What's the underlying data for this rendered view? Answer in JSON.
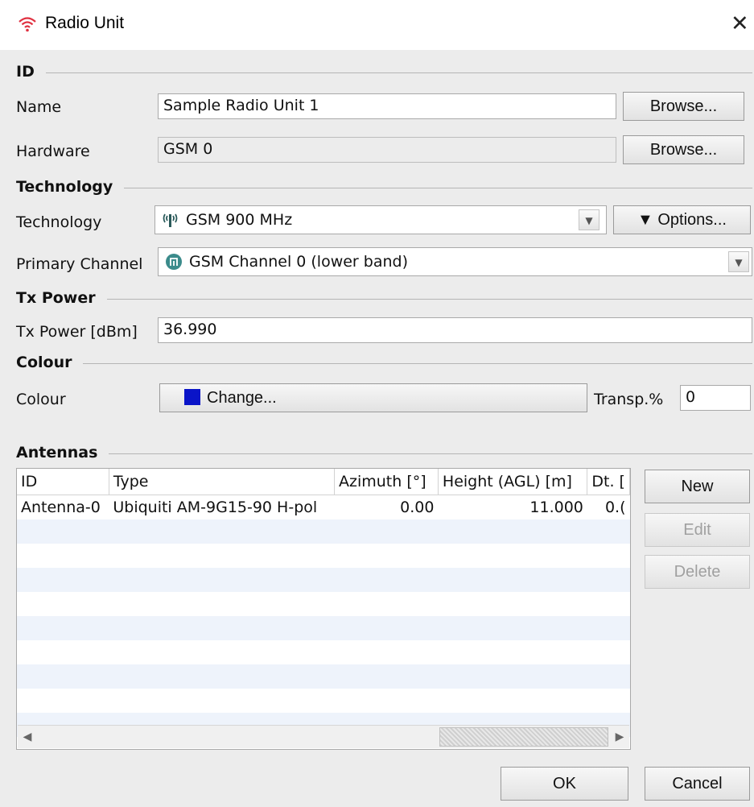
{
  "window": {
    "title": "Radio Unit",
    "close_glyph": "✕"
  },
  "id_section": {
    "title": "ID",
    "name_label": "Name",
    "name_value": "Sample Radio Unit 1",
    "name_browse": "Browse...",
    "hardware_label": "Hardware",
    "hardware_value": "GSM 0",
    "hardware_browse": "Browse..."
  },
  "technology_section": {
    "title": "Technology",
    "technology_label": "Technology",
    "technology_value": "GSM 900 MHz",
    "options_label": "▼ Options...",
    "primary_channel_label": "Primary Channel",
    "primary_channel_value": "GSM Channel 0 (lower band)"
  },
  "tx_power_section": {
    "title": "Tx Power",
    "label": "Tx Power [dBm]",
    "value": "36.990"
  },
  "colour_section": {
    "title": "Colour",
    "label": "Colour",
    "change_label": "Change...",
    "swatch_color": "#0a14c8",
    "transp_label": "Transp.%",
    "transp_value": "0"
  },
  "antennas_section": {
    "title": "Antennas",
    "columns": [
      "ID",
      "Type",
      "Azimuth [°]",
      "Height (AGL) [m]",
      "Dt. ["
    ],
    "rows": [
      {
        "id": "Antenna-0",
        "type": "Ubiquiti AM-9G15-90 H-pol",
        "azimuth": "0.00",
        "height": "11.000",
        "dt": "0.("
      }
    ],
    "new_label": "New",
    "edit_label": "Edit",
    "delete_label": "Delete"
  },
  "footer": {
    "ok_label": "OK",
    "cancel_label": "Cancel"
  },
  "icons": {
    "app": "wifi-icon",
    "technology": "gsm-tower-icon",
    "channel": "channel-icon"
  },
  "colors": {
    "window_bg": "#ececec",
    "app_icon": "#e03040",
    "swatch": "#0a14c8"
  }
}
